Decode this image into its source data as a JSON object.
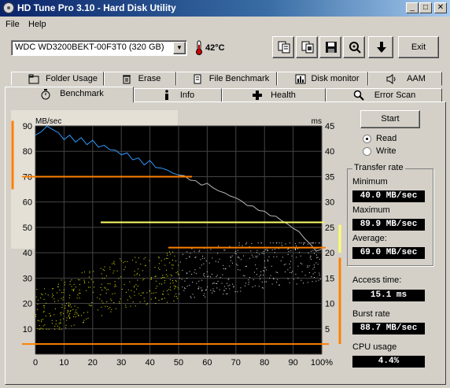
{
  "window": {
    "title": "HD Tune Pro 3.10 - Hard Disk Utility"
  },
  "menu": {
    "items": [
      "File",
      "Help"
    ]
  },
  "toolbar": {
    "drive": "WDC WD3200BEKT-00F3T0 (320 GB)",
    "temperature": "42°C",
    "exit_label": "Exit"
  },
  "tabs": {
    "row1": [
      "Folder Usage",
      "Erase",
      "File Benchmark",
      "Disk monitor",
      "AAM"
    ],
    "row2": [
      "Benchmark",
      "Info",
      "Health",
      "Error Scan"
    ],
    "active": "Benchmark"
  },
  "controls": {
    "start_label": "Start",
    "read_label": "Read",
    "write_label": "Write",
    "selected_mode": "Read"
  },
  "results": {
    "transfer_rate_title": "Transfer rate",
    "minimum_label": "Minimum",
    "minimum_value": "40.0 MB/sec",
    "maximum_label": "Maximum",
    "maximum_value": "89.9 MB/sec",
    "average_label": "Average:",
    "average_value": "69.0 MB/sec",
    "access_time_label": "Access time:",
    "access_time_value": "15.1 ms",
    "burst_rate_label": "Burst rate",
    "burst_rate_value": "88.7 MB/sec",
    "cpu_usage_label": "CPU usage",
    "cpu_usage_value": "4.4%"
  },
  "colors": {
    "transfer_line": "#2e9bff",
    "transfer_line_faded": "#b8b8b8",
    "access_points": "#f0f000",
    "access_points_faded": "#e8e8e8",
    "annotation": "#ff8000",
    "annotation_yellow": "#ffff66",
    "plot_bg": "#000000"
  },
  "chart_data": {
    "type": "line",
    "ylabel_left": "MB/sec",
    "ylabel_right": "ms",
    "y_left_ticks": [
      "90",
      "80",
      "70",
      "60",
      "50",
      "40",
      "30",
      "20",
      "10"
    ],
    "y_right_ticks": [
      "45",
      "40",
      "35",
      "30",
      "25",
      "20",
      "15",
      "10",
      "5"
    ],
    "x_ticks": [
      "0",
      "10",
      "20",
      "30",
      "40",
      "50",
      "60",
      "70",
      "80",
      "90",
      "100%"
    ],
    "xlim": [
      0,
      100
    ],
    "ylim_left": [
      0,
      90
    ],
    "ylim_right": [
      0,
      45
    ],
    "grid": true,
    "series": [
      {
        "name": "Transfer rate",
        "unit": "MB/sec",
        "axis": "left",
        "x": [
          0,
          2,
          4,
          6,
          8,
          10,
          12,
          14,
          16,
          18,
          20,
          22,
          24,
          26,
          28,
          30,
          32,
          34,
          36,
          38,
          40,
          42,
          44,
          46,
          48,
          50,
          52,
          54,
          56,
          58,
          60,
          62,
          64,
          66,
          68,
          70,
          72,
          74,
          76,
          78,
          80,
          82,
          84,
          86,
          88,
          90,
          92,
          94,
          96,
          98,
          100
        ],
        "values": [
          86,
          88,
          89.5,
          89,
          87,
          85,
          86,
          84,
          85,
          83,
          84,
          82,
          82,
          81,
          80,
          79,
          79,
          77,
          77,
          75,
          76,
          74,
          73,
          73,
          71,
          71,
          70,
          69,
          68,
          67,
          67,
          66,
          64,
          64,
          62,
          62,
          60,
          59,
          58,
          57,
          56,
          55,
          54,
          53,
          51,
          50,
          48,
          46,
          43,
          41,
          41
        ]
      },
      {
        "name": "Access time",
        "unit": "ms",
        "axis": "right",
        "type": "scatter",
        "min_ms": 5,
        "max_ms": 22,
        "mean_ms": 15.1
      }
    ]
  }
}
